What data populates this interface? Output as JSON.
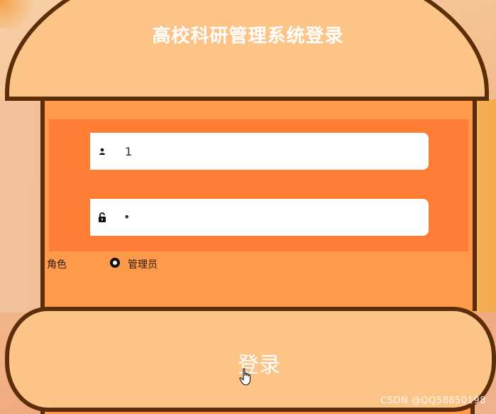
{
  "page": {
    "title": "高校科研管理系统登录"
  },
  "form": {
    "username_value": "1",
    "password_value": "•",
    "role_label": "角色",
    "role_option": "管理员",
    "login_label": "登录"
  },
  "icons": {
    "username": "user-icon",
    "password": "lock-icon",
    "cursor": "hand-pointer-icon"
  },
  "watermark": "CSDN @QQ58850198",
  "colors": {
    "bun": "#fdc487",
    "outline": "#5b2d08",
    "filling": "#fe9a4a",
    "filling_band": "#ff7d34"
  }
}
